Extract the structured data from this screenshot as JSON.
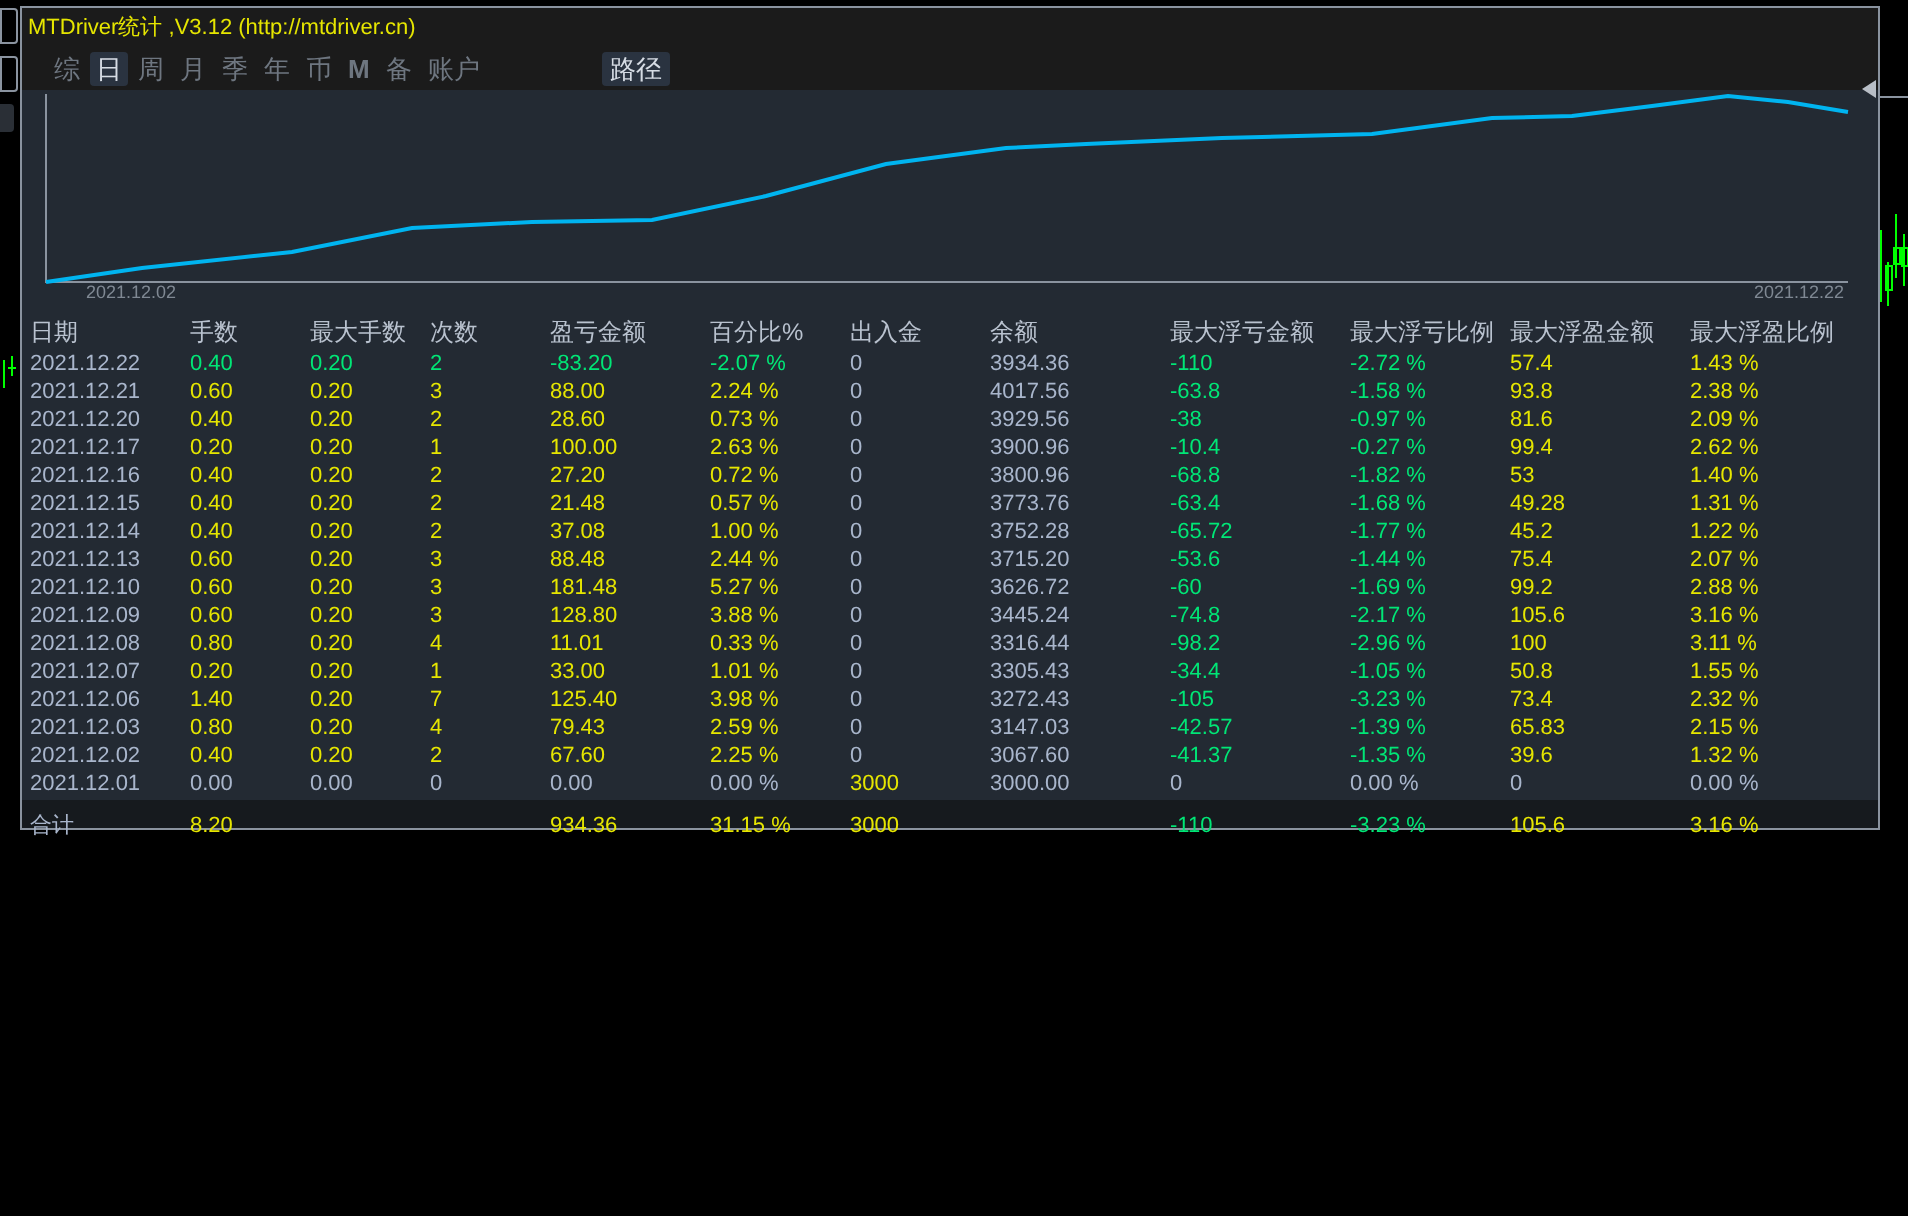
{
  "window": {
    "title": "MTDriver统计 ,V3.12 (http://mtdriver.cn)"
  },
  "tabs": [
    {
      "label": "综",
      "selected": false
    },
    {
      "label": "日",
      "selected": true
    },
    {
      "label": "周",
      "selected": false
    },
    {
      "label": "月",
      "selected": false
    },
    {
      "label": "季",
      "selected": false
    },
    {
      "label": "年",
      "selected": false
    },
    {
      "label": "币",
      "selected": false
    },
    {
      "label": "M",
      "selected": false
    },
    {
      "label": "备",
      "selected": false
    },
    {
      "label": "账户",
      "selected": false
    }
  ],
  "path_button": "路径",
  "chart": {
    "x_start": "2021.12.02",
    "x_end": "2021.12.22"
  },
  "table": {
    "columns": [
      "日期",
      "手数",
      "最大手数",
      "次数",
      "盈亏金额",
      "百分比%",
      "出入金",
      "余额",
      "最大浮亏金额",
      "最大浮亏比例",
      "最大浮盈金额",
      "最大浮盈比例"
    ],
    "rows": [
      {
        "cells": [
          {
            "text": "2021.12.22",
            "color": "#a9b6cc"
          },
          {
            "text": "0.40",
            "color": "#00e676"
          },
          {
            "text": "0.20",
            "color": "#00e676"
          },
          {
            "text": "2",
            "color": "#00e676"
          },
          {
            "text": "-83.20",
            "color": "#00e676"
          },
          {
            "text": "-2.07 %",
            "color": "#00e676"
          },
          {
            "text": "0",
            "color": "#a9b6cc"
          },
          {
            "text": "3934.36",
            "color": "#a9b6cc"
          },
          {
            "text": "-110",
            "color": "#00e676"
          },
          {
            "text": "-2.72 %",
            "color": "#00e676"
          },
          {
            "text": "57.4",
            "color": "#e6e600"
          },
          {
            "text": "1.43 %",
            "color": "#e6e600"
          }
        ]
      },
      {
        "cells": [
          {
            "text": "2021.12.21",
            "color": "#a9b6cc"
          },
          {
            "text": "0.60",
            "color": "#e6e600"
          },
          {
            "text": "0.20",
            "color": "#e6e600"
          },
          {
            "text": "3",
            "color": "#e6e600"
          },
          {
            "text": "88.00",
            "color": "#e6e600"
          },
          {
            "text": "2.24 %",
            "color": "#e6e600"
          },
          {
            "text": "0",
            "color": "#a9b6cc"
          },
          {
            "text": "4017.56",
            "color": "#a9b6cc"
          },
          {
            "text": "-63.8",
            "color": "#00e676"
          },
          {
            "text": "-1.58 %",
            "color": "#00e676"
          },
          {
            "text": "93.8",
            "color": "#e6e600"
          },
          {
            "text": "2.38 %",
            "color": "#e6e600"
          }
        ]
      },
      {
        "cells": [
          {
            "text": "2021.12.20",
            "color": "#a9b6cc"
          },
          {
            "text": "0.40",
            "color": "#e6e600"
          },
          {
            "text": "0.20",
            "color": "#e6e600"
          },
          {
            "text": "2",
            "color": "#e6e600"
          },
          {
            "text": "28.60",
            "color": "#e6e600"
          },
          {
            "text": "0.73 %",
            "color": "#e6e600"
          },
          {
            "text": "0",
            "color": "#a9b6cc"
          },
          {
            "text": "3929.56",
            "color": "#a9b6cc"
          },
          {
            "text": "-38",
            "color": "#00e676"
          },
          {
            "text": "-0.97 %",
            "color": "#00e676"
          },
          {
            "text": "81.6",
            "color": "#e6e600"
          },
          {
            "text": "2.09 %",
            "color": "#e6e600"
          }
        ]
      },
      {
        "cells": [
          {
            "text": "2021.12.17",
            "color": "#a9b6cc"
          },
          {
            "text": "0.20",
            "color": "#e6e600"
          },
          {
            "text": "0.20",
            "color": "#e6e600"
          },
          {
            "text": "1",
            "color": "#e6e600"
          },
          {
            "text": "100.00",
            "color": "#e6e600"
          },
          {
            "text": "2.63 %",
            "color": "#e6e600"
          },
          {
            "text": "0",
            "color": "#a9b6cc"
          },
          {
            "text": "3900.96",
            "color": "#a9b6cc"
          },
          {
            "text": "-10.4",
            "color": "#00e676"
          },
          {
            "text": "-0.27 %",
            "color": "#00e676"
          },
          {
            "text": "99.4",
            "color": "#e6e600"
          },
          {
            "text": "2.62 %",
            "color": "#e6e600"
          }
        ]
      },
      {
        "cells": [
          {
            "text": "2021.12.16",
            "color": "#a9b6cc"
          },
          {
            "text": "0.40",
            "color": "#e6e600"
          },
          {
            "text": "0.20",
            "color": "#e6e600"
          },
          {
            "text": "2",
            "color": "#e6e600"
          },
          {
            "text": "27.20",
            "color": "#e6e600"
          },
          {
            "text": "0.72 %",
            "color": "#e6e600"
          },
          {
            "text": "0",
            "color": "#a9b6cc"
          },
          {
            "text": "3800.96",
            "color": "#a9b6cc"
          },
          {
            "text": "-68.8",
            "color": "#00e676"
          },
          {
            "text": "-1.82 %",
            "color": "#00e676"
          },
          {
            "text": "53",
            "color": "#e6e600"
          },
          {
            "text": "1.40 %",
            "color": "#e6e600"
          }
        ]
      },
      {
        "cells": [
          {
            "text": "2021.12.15",
            "color": "#a9b6cc"
          },
          {
            "text": "0.40",
            "color": "#e6e600"
          },
          {
            "text": "0.20",
            "color": "#e6e600"
          },
          {
            "text": "2",
            "color": "#e6e600"
          },
          {
            "text": "21.48",
            "color": "#e6e600"
          },
          {
            "text": "0.57 %",
            "color": "#e6e600"
          },
          {
            "text": "0",
            "color": "#a9b6cc"
          },
          {
            "text": "3773.76",
            "color": "#a9b6cc"
          },
          {
            "text": "-63.4",
            "color": "#00e676"
          },
          {
            "text": "-1.68 %",
            "color": "#00e676"
          },
          {
            "text": "49.28",
            "color": "#e6e600"
          },
          {
            "text": "1.31 %",
            "color": "#e6e600"
          }
        ]
      },
      {
        "cells": [
          {
            "text": "2021.12.14",
            "color": "#a9b6cc"
          },
          {
            "text": "0.40",
            "color": "#e6e600"
          },
          {
            "text": "0.20",
            "color": "#e6e600"
          },
          {
            "text": "2",
            "color": "#e6e600"
          },
          {
            "text": "37.08",
            "color": "#e6e600"
          },
          {
            "text": "1.00 %",
            "color": "#e6e600"
          },
          {
            "text": "0",
            "color": "#a9b6cc"
          },
          {
            "text": "3752.28",
            "color": "#a9b6cc"
          },
          {
            "text": "-65.72",
            "color": "#00e676"
          },
          {
            "text": "-1.77 %",
            "color": "#00e676"
          },
          {
            "text": "45.2",
            "color": "#e6e600"
          },
          {
            "text": "1.22 %",
            "color": "#e6e600"
          }
        ]
      },
      {
        "cells": [
          {
            "text": "2021.12.13",
            "color": "#a9b6cc"
          },
          {
            "text": "0.60",
            "color": "#e6e600"
          },
          {
            "text": "0.20",
            "color": "#e6e600"
          },
          {
            "text": "3",
            "color": "#e6e600"
          },
          {
            "text": "88.48",
            "color": "#e6e600"
          },
          {
            "text": "2.44 %",
            "color": "#e6e600"
          },
          {
            "text": "0",
            "color": "#a9b6cc"
          },
          {
            "text": "3715.20",
            "color": "#a9b6cc"
          },
          {
            "text": "-53.6",
            "color": "#00e676"
          },
          {
            "text": "-1.44 %",
            "color": "#00e676"
          },
          {
            "text": "75.4",
            "color": "#e6e600"
          },
          {
            "text": "2.07 %",
            "color": "#e6e600"
          }
        ]
      },
      {
        "cells": [
          {
            "text": "2021.12.10",
            "color": "#a9b6cc"
          },
          {
            "text": "0.60",
            "color": "#e6e600"
          },
          {
            "text": "0.20",
            "color": "#e6e600"
          },
          {
            "text": "3",
            "color": "#e6e600"
          },
          {
            "text": "181.48",
            "color": "#e6e600"
          },
          {
            "text": "5.27 %",
            "color": "#e6e600"
          },
          {
            "text": "0",
            "color": "#a9b6cc"
          },
          {
            "text": "3626.72",
            "color": "#a9b6cc"
          },
          {
            "text": "-60",
            "color": "#00e676"
          },
          {
            "text": "-1.69 %",
            "color": "#00e676"
          },
          {
            "text": "99.2",
            "color": "#e6e600"
          },
          {
            "text": "2.88 %",
            "color": "#e6e600"
          }
        ]
      },
      {
        "cells": [
          {
            "text": "2021.12.09",
            "color": "#a9b6cc"
          },
          {
            "text": "0.60",
            "color": "#e6e600"
          },
          {
            "text": "0.20",
            "color": "#e6e600"
          },
          {
            "text": "3",
            "color": "#e6e600"
          },
          {
            "text": "128.80",
            "color": "#e6e600"
          },
          {
            "text": "3.88 %",
            "color": "#e6e600"
          },
          {
            "text": "0",
            "color": "#a9b6cc"
          },
          {
            "text": "3445.24",
            "color": "#a9b6cc"
          },
          {
            "text": "-74.8",
            "color": "#00e676"
          },
          {
            "text": "-2.17 %",
            "color": "#00e676"
          },
          {
            "text": "105.6",
            "color": "#e6e600"
          },
          {
            "text": "3.16 %",
            "color": "#e6e600"
          }
        ]
      },
      {
        "cells": [
          {
            "text": "2021.12.08",
            "color": "#a9b6cc"
          },
          {
            "text": "0.80",
            "color": "#e6e600"
          },
          {
            "text": "0.20",
            "color": "#e6e600"
          },
          {
            "text": "4",
            "color": "#e6e600"
          },
          {
            "text": "11.01",
            "color": "#e6e600"
          },
          {
            "text": "0.33 %",
            "color": "#e6e600"
          },
          {
            "text": "0",
            "color": "#a9b6cc"
          },
          {
            "text": "3316.44",
            "color": "#a9b6cc"
          },
          {
            "text": "-98.2",
            "color": "#00e676"
          },
          {
            "text": "-2.96 %",
            "color": "#00e676"
          },
          {
            "text": "100",
            "color": "#e6e600"
          },
          {
            "text": "3.11 %",
            "color": "#e6e600"
          }
        ]
      },
      {
        "cells": [
          {
            "text": "2021.12.07",
            "color": "#a9b6cc"
          },
          {
            "text": "0.20",
            "color": "#e6e600"
          },
          {
            "text": "0.20",
            "color": "#e6e600"
          },
          {
            "text": "1",
            "color": "#e6e600"
          },
          {
            "text": "33.00",
            "color": "#e6e600"
          },
          {
            "text": "1.01 %",
            "color": "#e6e600"
          },
          {
            "text": "0",
            "color": "#a9b6cc"
          },
          {
            "text": "3305.43",
            "color": "#a9b6cc"
          },
          {
            "text": "-34.4",
            "color": "#00e676"
          },
          {
            "text": "-1.05 %",
            "color": "#00e676"
          },
          {
            "text": "50.8",
            "color": "#e6e600"
          },
          {
            "text": "1.55 %",
            "color": "#e6e600"
          }
        ]
      },
      {
        "cells": [
          {
            "text": "2021.12.06",
            "color": "#a9b6cc"
          },
          {
            "text": "1.40",
            "color": "#e6e600"
          },
          {
            "text": "0.20",
            "color": "#e6e600"
          },
          {
            "text": "7",
            "color": "#e6e600"
          },
          {
            "text": "125.40",
            "color": "#e6e600"
          },
          {
            "text": "3.98 %",
            "color": "#e6e600"
          },
          {
            "text": "0",
            "color": "#a9b6cc"
          },
          {
            "text": "3272.43",
            "color": "#a9b6cc"
          },
          {
            "text": "-105",
            "color": "#00e676"
          },
          {
            "text": "-3.23 %",
            "color": "#00e676"
          },
          {
            "text": "73.4",
            "color": "#e6e600"
          },
          {
            "text": "2.32 %",
            "color": "#e6e600"
          }
        ]
      },
      {
        "cells": [
          {
            "text": "2021.12.03",
            "color": "#a9b6cc"
          },
          {
            "text": "0.80",
            "color": "#e6e600"
          },
          {
            "text": "0.20",
            "color": "#e6e600"
          },
          {
            "text": "4",
            "color": "#e6e600"
          },
          {
            "text": "79.43",
            "color": "#e6e600"
          },
          {
            "text": "2.59 %",
            "color": "#e6e600"
          },
          {
            "text": "0",
            "color": "#a9b6cc"
          },
          {
            "text": "3147.03",
            "color": "#a9b6cc"
          },
          {
            "text": "-42.57",
            "color": "#00e676"
          },
          {
            "text": "-1.39 %",
            "color": "#00e676"
          },
          {
            "text": "65.83",
            "color": "#e6e600"
          },
          {
            "text": "2.15 %",
            "color": "#e6e600"
          }
        ]
      },
      {
        "cells": [
          {
            "text": "2021.12.02",
            "color": "#a9b6cc"
          },
          {
            "text": "0.40",
            "color": "#e6e600"
          },
          {
            "text": "0.20",
            "color": "#e6e600"
          },
          {
            "text": "2",
            "color": "#e6e600"
          },
          {
            "text": "67.60",
            "color": "#e6e600"
          },
          {
            "text": "2.25 %",
            "color": "#e6e600"
          },
          {
            "text": "0",
            "color": "#a9b6cc"
          },
          {
            "text": "3067.60",
            "color": "#a9b6cc"
          },
          {
            "text": "-41.37",
            "color": "#00e676"
          },
          {
            "text": "-1.35 %",
            "color": "#00e676"
          },
          {
            "text": "39.6",
            "color": "#e6e600"
          },
          {
            "text": "1.32 %",
            "color": "#e6e600"
          }
        ]
      },
      {
        "cells": [
          {
            "text": "2021.12.01",
            "color": "#a9b6cc"
          },
          {
            "text": "0.00",
            "color": "#a9b6cc"
          },
          {
            "text": "0.00",
            "color": "#a9b6cc"
          },
          {
            "text": "0",
            "color": "#a9b6cc"
          },
          {
            "text": "0.00",
            "color": "#a9b6cc"
          },
          {
            "text": "0.00 %",
            "color": "#a9b6cc"
          },
          {
            "text": "3000",
            "color": "#e6e600"
          },
          {
            "text": "3000.00",
            "color": "#a9b6cc"
          },
          {
            "text": "0",
            "color": "#a9b6cc"
          },
          {
            "text": "0.00 %",
            "color": "#a9b6cc"
          },
          {
            "text": "0",
            "color": "#a9b6cc"
          },
          {
            "text": "0.00 %",
            "color": "#a9b6cc"
          }
        ]
      }
    ],
    "total": {
      "label": {
        "text": "合计",
        "color": "#a9b6cc"
      },
      "lots": {
        "text": "8.20",
        "color": "#e6e600"
      },
      "profit": {
        "text": "934.36",
        "color": "#e6e600"
      },
      "percent": {
        "text": "31.15 %",
        "color": "#e6e600"
      },
      "deposit": {
        "text": "3000",
        "color": "#e6e600"
      },
      "max_float_loss": {
        "text": "-110",
        "color": "#00e676"
      },
      "max_float_loss_pct": {
        "text": "-3.23 %",
        "color": "#00e676"
      },
      "max_float_profit": {
        "text": "105.6",
        "color": "#e6e600"
      },
      "max_float_profit_pct": {
        "text": "3.16 %",
        "color": "#e6e600"
      }
    }
  }
}
